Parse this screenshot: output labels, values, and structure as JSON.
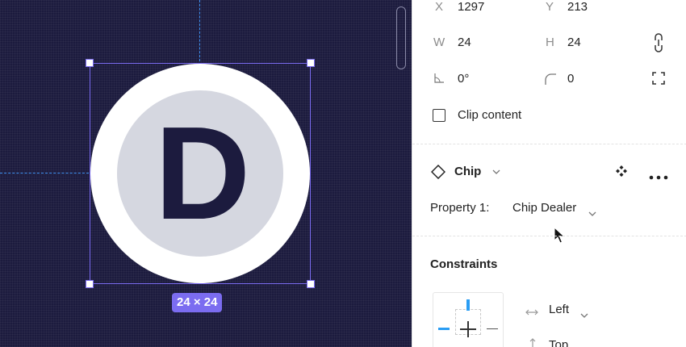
{
  "canvas": {
    "chip_letter": "D",
    "size_badge": "24 × 24",
    "colors": {
      "background": "#1c1b3e",
      "selection": "#7b6cf0",
      "guide": "#3d8ff0",
      "chip_outer": "#ffffff",
      "chip_inner": "#d5d7e0"
    }
  },
  "panel": {
    "x_label": "X",
    "x_value": "1297",
    "y_label": "Y",
    "y_value": "213",
    "w_label": "W",
    "w_value": "24",
    "h_label": "H",
    "h_value": "24",
    "rotation_value": "0°",
    "radius_value": "0",
    "clip_content_label": "Clip content",
    "clip_content_checked": false,
    "component_name": "Chip",
    "property_label": "Property 1:",
    "property_value": "Chip Dealer",
    "constraints_title": "Constraints",
    "constraint_horizontal": "Left",
    "constraint_vertical": "Top",
    "icons": [
      "angle-icon",
      "corner-radius-icon",
      "constrain-proportions-icon",
      "independent-corners-icon",
      "component-instance-icon",
      "go-to-main-component-icon",
      "more-icon",
      "mouse-cursor-icon"
    ]
  }
}
